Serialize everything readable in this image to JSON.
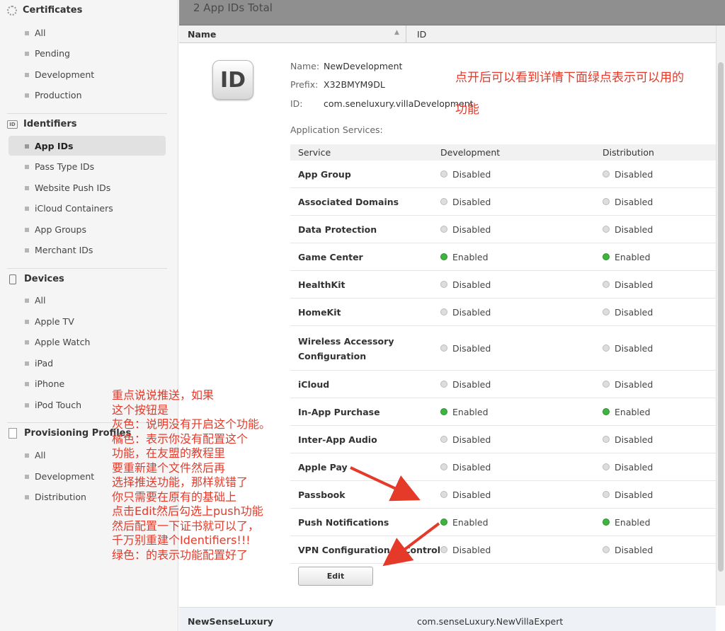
{
  "sidebar": {
    "certificates": {
      "title": "Certificates",
      "items": [
        "All",
        "Pending",
        "Development",
        "Production"
      ]
    },
    "identifiers": {
      "title": "Identifiers",
      "icon": "id-icon",
      "items": [
        "App IDs",
        "Pass Type IDs",
        "Website Push IDs",
        "iCloud Containers",
        "App Groups",
        "Merchant IDs"
      ],
      "active": "App IDs"
    },
    "devices": {
      "title": "Devices",
      "items": [
        "All",
        "Apple TV",
        "Apple Watch",
        "iPad",
        "iPhone",
        "iPod Touch"
      ]
    },
    "provisioning": {
      "title": "Provisioning Profiles",
      "items": [
        "All",
        "Development",
        "Distribution"
      ]
    }
  },
  "main": {
    "total_label": "2 App IDs Total",
    "columns": {
      "name": "Name",
      "id": "ID"
    },
    "detail": {
      "icon_text": "ID",
      "name_key": "Name:",
      "name_value": "NewDevelopment",
      "prefix_key": "Prefix:",
      "prefix_value": "X32BMYM9DL",
      "id_key": "ID:",
      "id_value": "com.seneluxury.villaDevelopment",
      "services_title": "Application Services:",
      "table_headers": {
        "service": "Service",
        "development": "Development",
        "distribution": "Distribution"
      },
      "services": [
        {
          "name": "App Group",
          "dev": "Disabled",
          "dist": "Disabled"
        },
        {
          "name": "Associated Domains",
          "dev": "Disabled",
          "dist": "Disabled"
        },
        {
          "name": "Data Protection",
          "dev": "Disabled",
          "dist": "Disabled"
        },
        {
          "name": "Game Center",
          "dev": "Enabled",
          "dist": "Enabled"
        },
        {
          "name": "HealthKit",
          "dev": "Disabled",
          "dist": "Disabled"
        },
        {
          "name": "HomeKit",
          "dev": "Disabled",
          "dist": "Disabled"
        },
        {
          "name": "Wireless Accessory",
          "name2": "Configuration",
          "dev": "Disabled",
          "dist": "Disabled"
        },
        {
          "name": "iCloud",
          "dev": "Disabled",
          "dist": "Disabled"
        },
        {
          "name": "In-App Purchase",
          "dev": "Enabled",
          "dist": "Enabled"
        },
        {
          "name": "Inter-App Audio",
          "dev": "Disabled",
          "dist": "Disabled"
        },
        {
          "name": "Apple Pay",
          "dev": "Disabled",
          "dist": "Disabled"
        },
        {
          "name": "Passbook",
          "dev": "Disabled",
          "dist": "Disabled"
        },
        {
          "name": "Push Notifications",
          "dev": "Enabled",
          "dist": "Enabled"
        },
        {
          "name": "VPN Configuration & Control",
          "dev": "Disabled",
          "dist": "Disabled"
        }
      ],
      "edit_label": "Edit"
    },
    "next_row": {
      "name": "NewSenseLuxury",
      "id": "com.senseLuxury.NewVillaExpert"
    }
  },
  "annotations": {
    "top": [
      "点开后可以看到详情下面绿点表示可以用的",
      "功能"
    ],
    "left": [
      "重点说说推送，如果",
      "这个按钮是",
      "灰色：说明没有开启这个功能。",
      "橘色：表示你没有配置这个",
      "功能，在友盟的教程里",
      "要重新建个文件然后再",
      "选择推送功能，那样就错了",
      "你只需要在原有的基础上",
      "点击Edit然后勾选上push功能",
      "然后配置一下证书就可以了，",
      "千万别重建个Identifiers!!!",
      "绿色：的表示功能配置好了"
    ]
  },
  "colors": {
    "enabled": "#3db43d",
    "disabled": "#dddddd",
    "annotation": "#e53a2a"
  }
}
